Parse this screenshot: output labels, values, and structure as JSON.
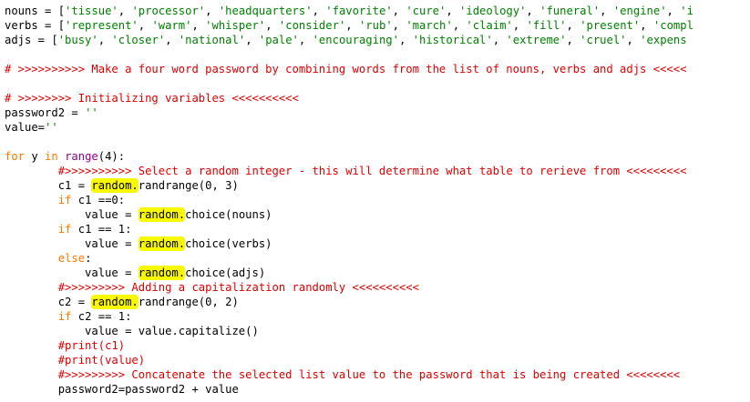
{
  "lines": [
    [
      {
        "t": "nouns = ["
      },
      {
        "t": "'tissue'",
        "c": "str"
      },
      {
        "t": ", "
      },
      {
        "t": "'processor'",
        "c": "str"
      },
      {
        "t": ", "
      },
      {
        "t": "'headquarters'",
        "c": "str"
      },
      {
        "t": ", "
      },
      {
        "t": "'favorite'",
        "c": "str"
      },
      {
        "t": ", "
      },
      {
        "t": "'cure'",
        "c": "str"
      },
      {
        "t": ", "
      },
      {
        "t": "'ideology'",
        "c": "str"
      },
      {
        "t": ", "
      },
      {
        "t": "'funeral'",
        "c": "str"
      },
      {
        "t": ", "
      },
      {
        "t": "'engine'",
        "c": "str"
      },
      {
        "t": ", "
      },
      {
        "t": "'i",
        "c": "str"
      }
    ],
    [
      {
        "t": "verbs = ["
      },
      {
        "t": "'represent'",
        "c": "str"
      },
      {
        "t": ", "
      },
      {
        "t": "'warm'",
        "c": "str"
      },
      {
        "t": ", "
      },
      {
        "t": "'whisper'",
        "c": "str"
      },
      {
        "t": ", "
      },
      {
        "t": "'consider'",
        "c": "str"
      },
      {
        "t": ", "
      },
      {
        "t": "'rub'",
        "c": "str"
      },
      {
        "t": ", "
      },
      {
        "t": "'march'",
        "c": "str"
      },
      {
        "t": ", "
      },
      {
        "t": "'claim'",
        "c": "str"
      },
      {
        "t": ", "
      },
      {
        "t": "'fill'",
        "c": "str"
      },
      {
        "t": ", "
      },
      {
        "t": "'present'",
        "c": "str"
      },
      {
        "t": ", "
      },
      {
        "t": "'compl",
        "c": "str"
      }
    ],
    [
      {
        "t": "adjs = ["
      },
      {
        "t": "'busy'",
        "c": "str"
      },
      {
        "t": ", "
      },
      {
        "t": "'closer'",
        "c": "str"
      },
      {
        "t": ", "
      },
      {
        "t": "'national'",
        "c": "str"
      },
      {
        "t": ", "
      },
      {
        "t": "'pale'",
        "c": "str"
      },
      {
        "t": ", "
      },
      {
        "t": "'encouraging'",
        "c": "str"
      },
      {
        "t": ", "
      },
      {
        "t": "'historical'",
        "c": "str"
      },
      {
        "t": ", "
      },
      {
        "t": "'extreme'",
        "c": "str"
      },
      {
        "t": ", "
      },
      {
        "t": "'cruel'",
        "c": "str"
      },
      {
        "t": ", "
      },
      {
        "t": "'expens",
        "c": "str"
      }
    ],
    [],
    [
      {
        "t": "# >>>>>>>>>> Make a four word password by combining words from the list of nouns, verbs and adjs <<<<<",
        "c": "com"
      }
    ],
    [],
    [
      {
        "t": "# >>>>>>>> Initializing variables <<<<<<<<<<",
        "c": "com"
      }
    ],
    [
      {
        "t": "password2 = "
      },
      {
        "t": "''",
        "c": "str"
      }
    ],
    [
      {
        "t": "value="
      },
      {
        "t": "''",
        "c": "str"
      }
    ],
    [],
    [
      {
        "t": "for",
        "c": "kw"
      },
      {
        "t": " y "
      },
      {
        "t": "in",
        "c": "kw"
      },
      {
        "t": " "
      },
      {
        "t": "range",
        "c": "bi"
      },
      {
        "t": "(4):"
      }
    ],
    [
      {
        "t": "        "
      },
      {
        "t": "#>>>>>>>>>> Select a random integer - this will determine what table to rerieve from <<<<<<<<<",
        "c": "com"
      }
    ],
    [
      {
        "t": "        c1 = "
      },
      {
        "t": "random.",
        "c": "hl"
      },
      {
        "t": "randrange(0, 3)"
      }
    ],
    [
      {
        "t": "        "
      },
      {
        "t": "if",
        "c": "kw"
      },
      {
        "t": " c1 ==0:"
      }
    ],
    [
      {
        "t": "            value = "
      },
      {
        "t": "random.",
        "c": "hl"
      },
      {
        "t": "choice(nouns)"
      }
    ],
    [
      {
        "t": "        "
      },
      {
        "t": "if",
        "c": "kw"
      },
      {
        "t": " c1 == 1:"
      }
    ],
    [
      {
        "t": "            value = "
      },
      {
        "t": "random.",
        "c": "hl"
      },
      {
        "t": "choice(verbs)"
      }
    ],
    [
      {
        "t": "        "
      },
      {
        "t": "else",
        "c": "kw"
      },
      {
        "t": ":"
      }
    ],
    [
      {
        "t": "            value = "
      },
      {
        "t": "random.",
        "c": "hl"
      },
      {
        "t": "choice(adjs)"
      }
    ],
    [
      {
        "t": "        "
      },
      {
        "t": "#>>>>>>>>> Adding a capitalization randomly <<<<<<<<<<",
        "c": "com"
      }
    ],
    [
      {
        "t": "        c2 = "
      },
      {
        "t": "random.",
        "c": "hl"
      },
      {
        "t": "randrange(0, 2)"
      }
    ],
    [
      {
        "t": "        "
      },
      {
        "t": "if",
        "c": "kw"
      },
      {
        "t": " c2 == 1:"
      }
    ],
    [
      {
        "t": "            value = value.capitalize()"
      }
    ],
    [
      {
        "t": "        "
      },
      {
        "t": "#print(c1)",
        "c": "com"
      }
    ],
    [
      {
        "t": "        "
      },
      {
        "t": "#print(value)",
        "c": "com"
      }
    ],
    [
      {
        "t": "        "
      },
      {
        "t": "#>>>>>>>>> Concatenate the selected list value to the password that is being created <<<<<<<<",
        "c": "com"
      }
    ],
    [
      {
        "t": "        password2=password2 + value"
      }
    ]
  ],
  "colors": {
    "string": "#008000",
    "comment": "#dd0000",
    "keyword": "#ff7700",
    "builtin": "#900090",
    "highlight": "#f8f800"
  }
}
